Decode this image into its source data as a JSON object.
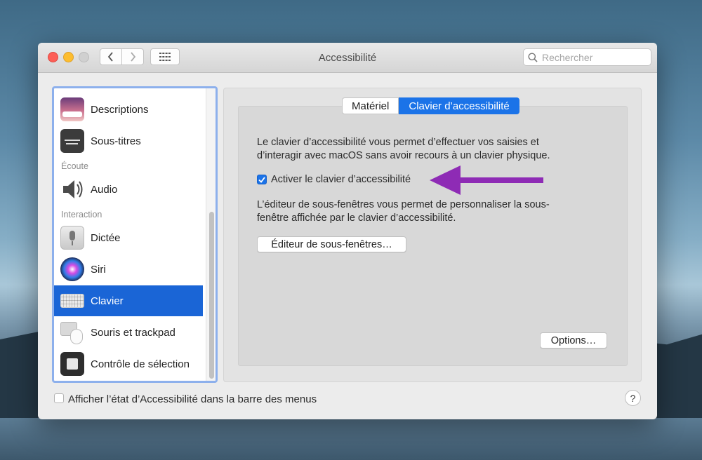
{
  "window": {
    "title": "Accessibilité"
  },
  "search": {
    "placeholder": "Rechercher"
  },
  "sidebar": {
    "items": [
      {
        "label": "Descriptions"
      },
      {
        "label": "Sous-titres"
      },
      {
        "label": "Audio"
      },
      {
        "label": "Dictée"
      },
      {
        "label": "Siri"
      },
      {
        "label": "Clavier",
        "selected": true
      },
      {
        "label": "Souris et trackpad"
      },
      {
        "label": "Contrôle de sélection"
      }
    ],
    "sections": {
      "ecoute": "Écoute",
      "interaction": "Interaction"
    }
  },
  "tabs": [
    {
      "label": "Matériel"
    },
    {
      "label": "Clavier d’accessibilité",
      "active": true
    }
  ],
  "pane": {
    "intro_line1": "Le clavier d’accessibilité vous permet d’effectuer vos saisies et",
    "intro_line2": "d’interagir avec macOS sans avoir recours à un clavier physique.",
    "enable_checkbox_label": "Activer le clavier d’accessibilité",
    "enable_checked": true,
    "editor_line1": "L’éditeur de sous-fenêtres vous permet de personnaliser la sous-",
    "editor_line2": "fenêtre affichée par le clavier d’accessibilité.",
    "editor_button": "Éditeur de sous-fenêtres…",
    "options_button": "Options…"
  },
  "footer": {
    "menubar_checkbox_label": "Afficher l’état d’Accessibilité dans la barre des menus",
    "menubar_checked": false,
    "help_label": "?"
  },
  "colors": {
    "accent": "#1b73e8",
    "annotation_arrow": "#8e2bb5",
    "sidebar_selection": "#1a65d6"
  },
  "icons": [
    "back-chevron-icon",
    "forward-chevron-icon",
    "grid-icon",
    "search-icon",
    "descriptions-icon",
    "subtitles-icon",
    "audio-speaker-icon",
    "microphone-icon",
    "siri-icon",
    "keyboard-icon",
    "mouse-trackpad-icon",
    "switch-control-icon",
    "checkmark-icon",
    "purple-arrow-annotation"
  ]
}
